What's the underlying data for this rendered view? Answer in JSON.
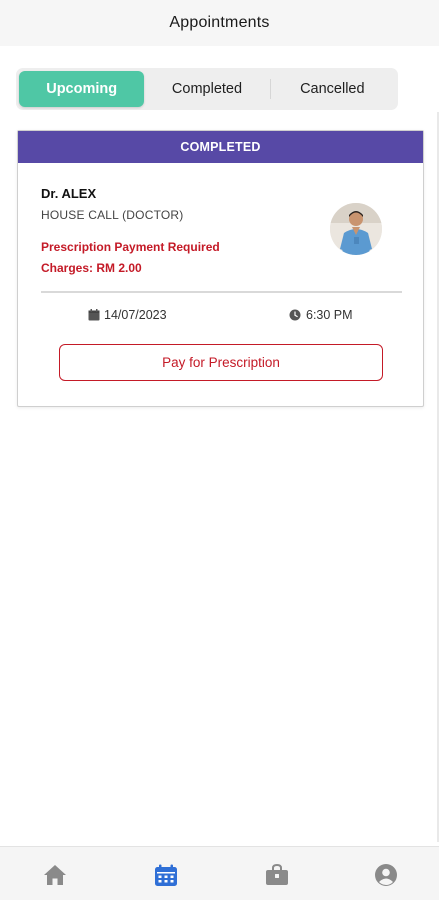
{
  "header": {
    "title": "Appointments"
  },
  "tabs": [
    {
      "label": "Upcoming",
      "active": true
    },
    {
      "label": "Completed",
      "active": false
    },
    {
      "label": "Cancelled",
      "active": false
    }
  ],
  "appointment": {
    "status": "COMPLETED",
    "doctor": "Dr. ALEX",
    "visit_type": "HOUSE CALL (DOCTOR)",
    "payment_note": "Prescription Payment Required",
    "charges": "Charges: RM 2.00",
    "date": "14/07/2023",
    "time": "6:30 PM",
    "pay_button": "Pay for Prescription"
  },
  "bottom_nav": {
    "items": [
      {
        "icon": "home-icon",
        "active": false
      },
      {
        "icon": "calendar-icon",
        "active": true
      },
      {
        "icon": "bag-icon",
        "active": false
      },
      {
        "icon": "profile-icon",
        "active": false
      }
    ]
  },
  "colors": {
    "accent_teal": "#4fc7a5",
    "banner_purple": "#5749a6",
    "alert_red": "#c41a27",
    "nav_active_blue": "#2f6fd6",
    "nav_inactive_gray": "#8a8a8a"
  }
}
